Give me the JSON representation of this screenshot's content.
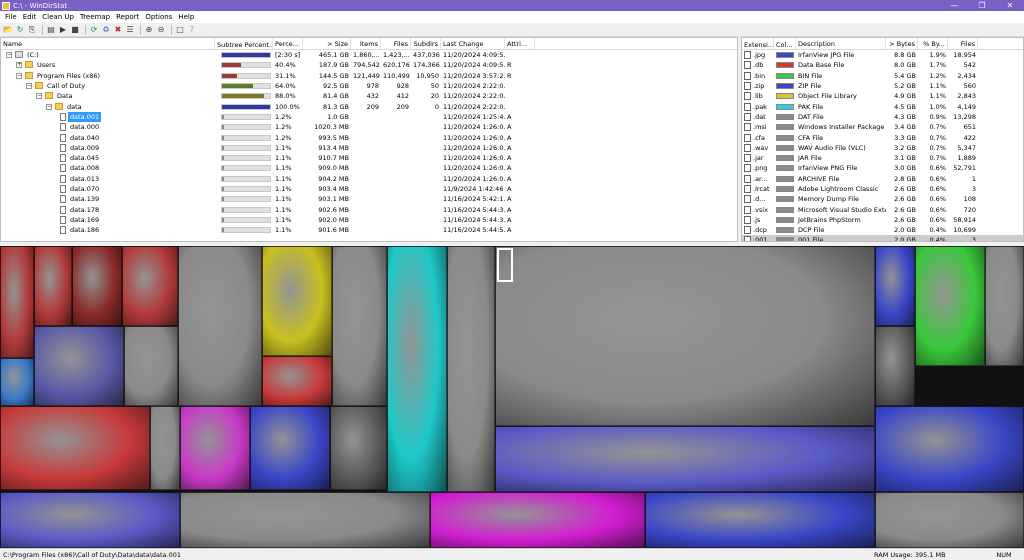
{
  "window": {
    "title": "C:\\ - WinDirStat"
  },
  "menu": [
    "File",
    "Edit",
    "Clean Up",
    "Treemap",
    "Report",
    "Options",
    "Help"
  ],
  "toolbar_icons": [
    "open-icon",
    "refresh-icon",
    "copy-path-icon",
    "explorer-icon",
    "open-folder-icon",
    "command-prompt-icon",
    "refresh-selected-icon",
    "recycle-icon",
    "delete-icon",
    "properties-icon",
    "zoom-in-icon",
    "zoom-out-icon",
    "select-parent-icon",
    "help-icon"
  ],
  "tree_columns": [
    "Name",
    "Subtree Percent...",
    "Perce...",
    "> Size",
    "Items",
    "Files",
    "Subdirs",
    "Last Change",
    "Attri..."
  ],
  "tree_rows": [
    {
      "level": 0,
      "type": "drive",
      "expander": "-",
      "name": "(C:)",
      "bar": 1.0,
      "bar_color": "#2c3a9e",
      "perc": "[2:30 s]",
      "size": "465.1 GB",
      "items": "1,860,...",
      "files": "1,423,...",
      "subdirs": "437,036",
      "date": "11/20/2024  4:09:5...",
      "attr": ""
    },
    {
      "level": 1,
      "type": "folder",
      "expander": "+",
      "name": "Users",
      "bar": 0.4,
      "bar_color": "#9a3a3a",
      "perc": "40.4%",
      "size": "187.9 GB",
      "items": "794,542",
      "files": "620,176",
      "subdirs": "174,366",
      "date": "11/20/2024  4:09:5...",
      "attr": "R"
    },
    {
      "level": 1,
      "type": "folder",
      "expander": "-",
      "name": "Program Files (x86)",
      "bar": 0.31,
      "bar_color": "#9a3a3a",
      "perc": "31.1%",
      "size": "144.5 GB",
      "items": "121,449",
      "files": "110,499",
      "subdirs": "10,950",
      "date": "11/20/2024  3:57:2...",
      "attr": "R"
    },
    {
      "level": 2,
      "type": "folder",
      "expander": "-",
      "name": "Call of Duty",
      "bar": 0.64,
      "bar_color": "#5a7a2a",
      "perc": "64.0%",
      "size": "92.5 GB",
      "items": "978",
      "files": "928",
      "subdirs": "50",
      "date": "11/20/2024  2:22:0...",
      "attr": ""
    },
    {
      "level": 3,
      "type": "folder",
      "expander": "-",
      "name": "Data",
      "bar": 0.88,
      "bar_color": "#7a7a2a",
      "perc": "88.0%",
      "size": "81.4 GB",
      "items": "432",
      "files": "412",
      "subdirs": "20",
      "date": "11/20/2024  2:22:0...",
      "attr": ""
    },
    {
      "level": 4,
      "type": "folder",
      "expander": "-",
      "name": "data",
      "bar": 1.0,
      "bar_color": "#2c3a9e",
      "perc": "100.0%",
      "size": "81.3 GB",
      "items": "209",
      "files": "209",
      "subdirs": "0",
      "date": "11/20/2024  2:22:0...",
      "attr": ""
    },
    {
      "level": 5,
      "type": "file",
      "name": "data.001",
      "bar": 0.012,
      "bar_color": "#888",
      "perc": "1.2%",
      "size": "1.0 GB",
      "items": "",
      "files": "",
      "subdirs": "",
      "date": "11/20/2024  1:25:4...",
      "attr": "A",
      "selected": true
    },
    {
      "level": 5,
      "type": "file",
      "name": "data.000",
      "bar": 0.012,
      "bar_color": "#888",
      "perc": "1.2%",
      "size": "1020.3 MB",
      "items": "",
      "files": "",
      "subdirs": "",
      "date": "11/20/2024  1:26:0...",
      "attr": "A"
    },
    {
      "level": 5,
      "type": "file",
      "name": "data.040",
      "bar": 0.012,
      "bar_color": "#888",
      "perc": "1.2%",
      "size": "993.5 MB",
      "items": "",
      "files": "",
      "subdirs": "",
      "date": "11/20/2024  1:26:0...",
      "attr": "A"
    },
    {
      "level": 5,
      "type": "file",
      "name": "data.009",
      "bar": 0.011,
      "bar_color": "#888",
      "perc": "1.1%",
      "size": "913.4 MB",
      "items": "",
      "files": "",
      "subdirs": "",
      "date": "11/20/2024  1:26:0...",
      "attr": "A"
    },
    {
      "level": 5,
      "type": "file",
      "name": "data.045",
      "bar": 0.011,
      "bar_color": "#888",
      "perc": "1.1%",
      "size": "910.7 MB",
      "items": "",
      "files": "",
      "subdirs": "",
      "date": "11/20/2024  1:26:0...",
      "attr": "A"
    },
    {
      "level": 5,
      "type": "file",
      "name": "data.008",
      "bar": 0.011,
      "bar_color": "#888",
      "perc": "1.1%",
      "size": "909.0 MB",
      "items": "",
      "files": "",
      "subdirs": "",
      "date": "11/20/2024  1:26:0...",
      "attr": "A"
    },
    {
      "level": 5,
      "type": "file",
      "name": "data.013",
      "bar": 0.011,
      "bar_color": "#888",
      "perc": "1.1%",
      "size": "904.2 MB",
      "items": "",
      "files": "",
      "subdirs": "",
      "date": "11/20/2024  1:26:0...",
      "attr": "A"
    },
    {
      "level": 5,
      "type": "file",
      "name": "data.070",
      "bar": 0.011,
      "bar_color": "#888",
      "perc": "1.1%",
      "size": "903.4 MB",
      "items": "",
      "files": "",
      "subdirs": "",
      "date": "11/9/2024  1:42:46 ...",
      "attr": "A"
    },
    {
      "level": 5,
      "type": "file",
      "name": "data.139",
      "bar": 0.011,
      "bar_color": "#888",
      "perc": "1.1%",
      "size": "903.1 MB",
      "items": "",
      "files": "",
      "subdirs": "",
      "date": "11/16/2024  5:42:1...",
      "attr": "A"
    },
    {
      "level": 5,
      "type": "file",
      "name": "data.178",
      "bar": 0.011,
      "bar_color": "#888",
      "perc": "1.1%",
      "size": "902.6 MB",
      "items": "",
      "files": "",
      "subdirs": "",
      "date": "11/16/2024  5:44:3...",
      "attr": "A"
    },
    {
      "level": 5,
      "type": "file",
      "name": "data.169",
      "bar": 0.011,
      "bar_color": "#888",
      "perc": "1.1%",
      "size": "902.0 MB",
      "items": "",
      "files": "",
      "subdirs": "",
      "date": "11/16/2024  5:44:3...",
      "attr": "A"
    },
    {
      "level": 5,
      "type": "file",
      "name": "data.186",
      "bar": 0.011,
      "bar_color": "#888",
      "perc": "1.1%",
      "size": "901.6 MB",
      "items": "",
      "files": "",
      "subdirs": "",
      "date": "11/16/2024  5:44:5...",
      "attr": "A"
    }
  ],
  "ext_columns": [
    "Extensi...",
    "Col...",
    "Description",
    "> Bytes",
    "% By...",
    "Files"
  ],
  "ext_rows": [
    {
      "ext": ".jpg",
      "color": "#3a46c8",
      "desc": "IrfanView JPG File",
      "bytes": "8.8 GB",
      "pct": "1.9%",
      "files": "18,954"
    },
    {
      "ext": ".db",
      "color": "#d23a3a",
      "desc": "Data Base File",
      "bytes": "8.0 GB",
      "pct": "1.7%",
      "files": "542"
    },
    {
      "ext": ".bin",
      "color": "#3cc84a",
      "desc": "BIN File",
      "bytes": "5.4 GB",
      "pct": "1.2%",
      "files": "2,434"
    },
    {
      "ext": ".zip",
      "color": "#3a46c8",
      "desc": "ZIP File",
      "bytes": "5.2 GB",
      "pct": "1.1%",
      "files": "560"
    },
    {
      "ext": ".lib",
      "color": "#d2c83a",
      "desc": "Object File Library",
      "bytes": "4.9 GB",
      "pct": "1.1%",
      "files": "2,843"
    },
    {
      "ext": ".pak",
      "color": "#2ed2d2",
      "desc": "PAK File",
      "bytes": "4.5 GB",
      "pct": "1.0%",
      "files": "4,149"
    },
    {
      "ext": ".dat",
      "color": "#8a8a8a",
      "desc": "DAT File",
      "bytes": "4.3 GB",
      "pct": "0.9%",
      "files": "13,298"
    },
    {
      "ext": ".msi",
      "color": "#8a8a8a",
      "desc": "Windows Installer Package",
      "bytes": "3.4 GB",
      "pct": "0.7%",
      "files": "651"
    },
    {
      "ext": ".cfa",
      "color": "#8a8a8a",
      "desc": "CFA File",
      "bytes": "3.3 GB",
      "pct": "0.7%",
      "files": "422"
    },
    {
      "ext": ".wav",
      "color": "#8a8a8a",
      "desc": "WAV Audio File (VLC)",
      "bytes": "3.2 GB",
      "pct": "0.7%",
      "files": "5,347"
    },
    {
      "ext": ".jar",
      "color": "#8a8a8a",
      "desc": "JAR File",
      "bytes": "3.1 GB",
      "pct": "0.7%",
      "files": "1,889"
    },
    {
      "ext": ".png",
      "color": "#8a8a8a",
      "desc": "IrfanView PNG File",
      "bytes": "3.0 GB",
      "pct": "0.6%",
      "files": "52,791"
    },
    {
      "ext": ".ar...",
      "color": "#8a8a8a",
      "desc": "ARCHIVE File",
      "bytes": "2.8 GB",
      "pct": "0.6%",
      "files": "1"
    },
    {
      "ext": ".lrcat",
      "color": "#8a8a8a",
      "desc": "Adobe Lightroom Classic",
      "bytes": "2.6 GB",
      "pct": "0.6%",
      "files": "3"
    },
    {
      "ext": ".d...",
      "color": "#8a8a8a",
      "desc": "Memory Dump File",
      "bytes": "2.6 GB",
      "pct": "0.6%",
      "files": "108"
    },
    {
      "ext": ".vsix",
      "color": "#8a8a8a",
      "desc": "Microsoft Visual Studio Exte...",
      "bytes": "2.6 GB",
      "pct": "0.6%",
      "files": "720"
    },
    {
      "ext": ".js",
      "color": "#8a8a8a",
      "desc": "JetBrains PhpStorm",
      "bytes": "2.6 GB",
      "pct": "0.6%",
      "files": "58,914"
    },
    {
      "ext": ".dcp",
      "color": "#8a8a8a",
      "desc": "DCP File",
      "bytes": "2.0 GB",
      "pct": "0.4%",
      "files": "10,699"
    },
    {
      "ext": ".001",
      "color": "#8a8a8a",
      "desc": "001 File",
      "bytes": "2.0 GB",
      "pct": "0.4%",
      "files": "3",
      "selected": true
    }
  ],
  "status": {
    "path": "C:\\Program Files (x86)\\Call of Duty\\Data\\data\\data.001",
    "ram": "RAM Usage:   395.1 MB",
    "num": "NUM"
  }
}
